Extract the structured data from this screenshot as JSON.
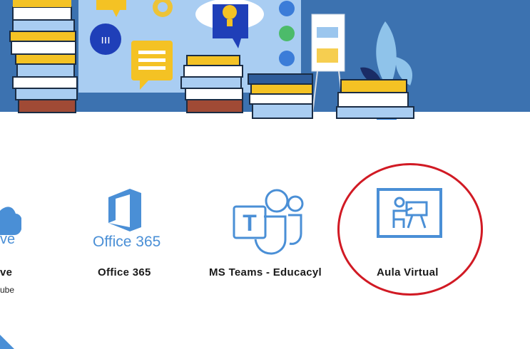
{
  "apps": [
    {
      "name": "ve",
      "logo_text": "ve",
      "subtitle": "ube",
      "icon": "cloud-icon"
    },
    {
      "name": "Office 365",
      "logo_text": "Office 365",
      "icon": "office-icon"
    },
    {
      "name": "MS Teams - Educacyl",
      "icon": "teams-icon"
    },
    {
      "name": "Aula Virtual",
      "icon": "classroom-icon"
    }
  ],
  "colors": {
    "banner": "#3c72b0",
    "logo_blue": "#4a8fd6",
    "highlight": "#d11a24"
  }
}
